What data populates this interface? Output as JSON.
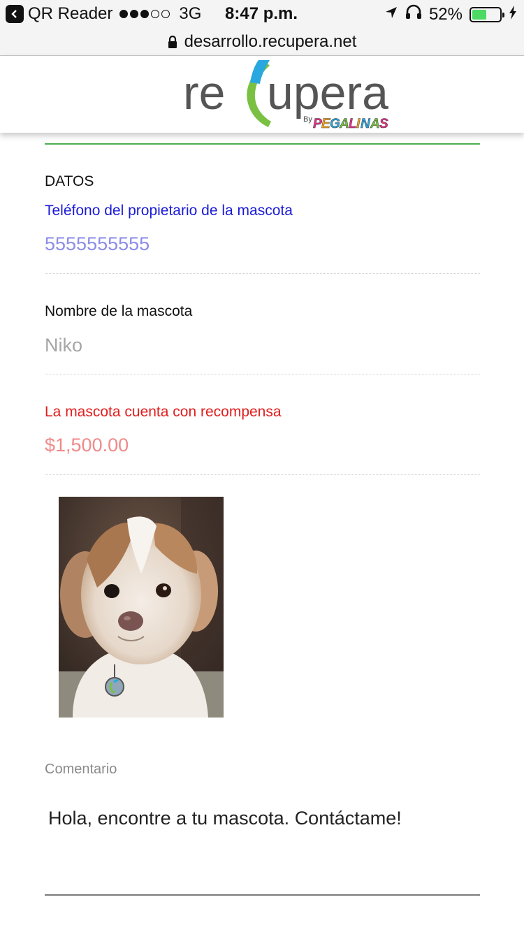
{
  "status_bar": {
    "back_app": "QR Reader",
    "network": "3G",
    "time": "8:47 p.m.",
    "battery": "52%",
    "battery_level": 0.52,
    "signal_bars_filled": 3,
    "signal_bars_total": 5
  },
  "browser": {
    "url": "desarrollo.recupera.net"
  },
  "logo": {
    "name": "recupera",
    "by": "By",
    "brand": "PEGALINAS"
  },
  "section": {
    "title": "DATOS"
  },
  "fields": {
    "phone_label": "Teléfono del propietario de la mascota",
    "phone_value": "5555555555",
    "pet_name_label": "Nombre de la mascota",
    "pet_name_value": "Niko",
    "reward_label": "La mascota cuenta con recompensa",
    "reward_value": "$1,500.00"
  },
  "comment": {
    "label": "Comentario",
    "text": "Hola, encontre a tu mascota. Contáctame!"
  },
  "colors": {
    "phone_label": "#1a1ad6",
    "phone_value": "#8c8ce8",
    "reward_label": "#e01e1e",
    "reward_value": "#f08a8a",
    "green_rule": "#4caf50",
    "battery_fill": "#4cd964"
  },
  "icons": [
    "back-arrow-icon",
    "location-arrow-icon",
    "headphones-icon",
    "battery-icon",
    "charging-bolt-icon",
    "lock-icon"
  ]
}
